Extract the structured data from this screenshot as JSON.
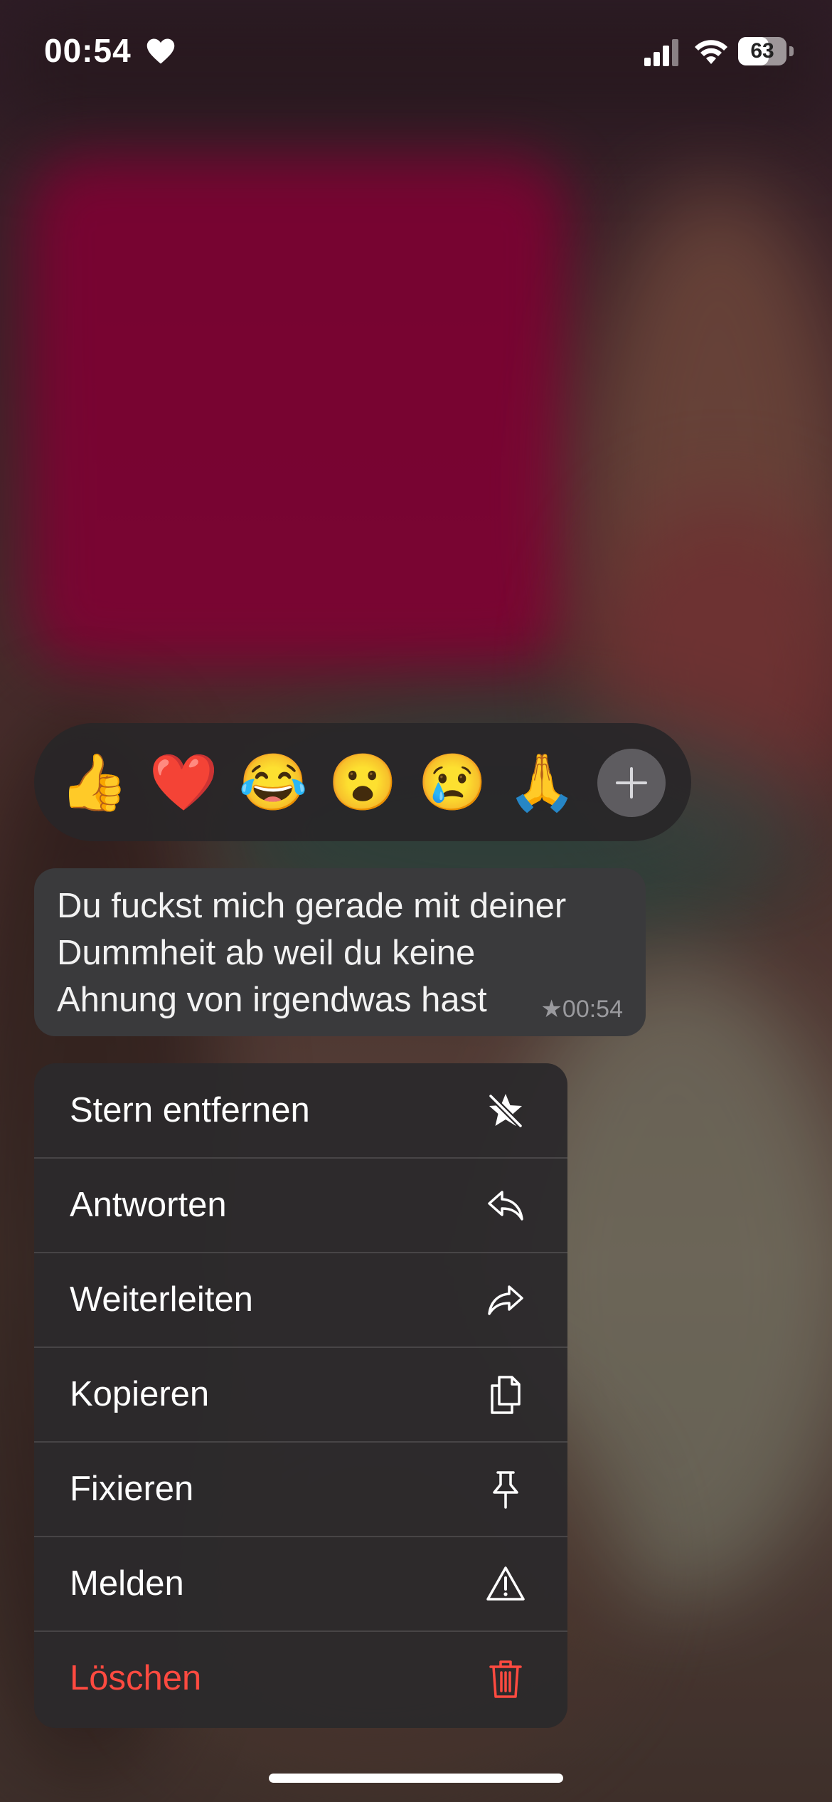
{
  "status_bar": {
    "time": "00:54",
    "battery_level": "63",
    "battery_fraction": 0.63
  },
  "reactions": {
    "emojis": [
      "👍",
      "❤️",
      "😂",
      "😮",
      "😢",
      "🙏"
    ],
    "more_icon": "plus-icon"
  },
  "message": {
    "lines": [
      "Du fuckst mich gerade mit deiner",
      "Dummheit ab weil du keine",
      "Ahnung von irgendwas hast"
    ],
    "star": "★",
    "time": "00:54"
  },
  "menu": {
    "items": [
      {
        "label": "Stern entfernen",
        "icon": "unstar-icon"
      },
      {
        "label": "Antworten",
        "icon": "reply-icon"
      },
      {
        "label": "Weiterleiten",
        "icon": "forward-icon"
      },
      {
        "label": "Kopieren",
        "icon": "copy-icon"
      },
      {
        "label": "Fixieren",
        "icon": "pin-icon"
      },
      {
        "label": "Melden",
        "icon": "warning-icon"
      },
      {
        "label": "Löschen",
        "icon": "trash-icon"
      }
    ],
    "danger_color": "#ff4a40"
  }
}
